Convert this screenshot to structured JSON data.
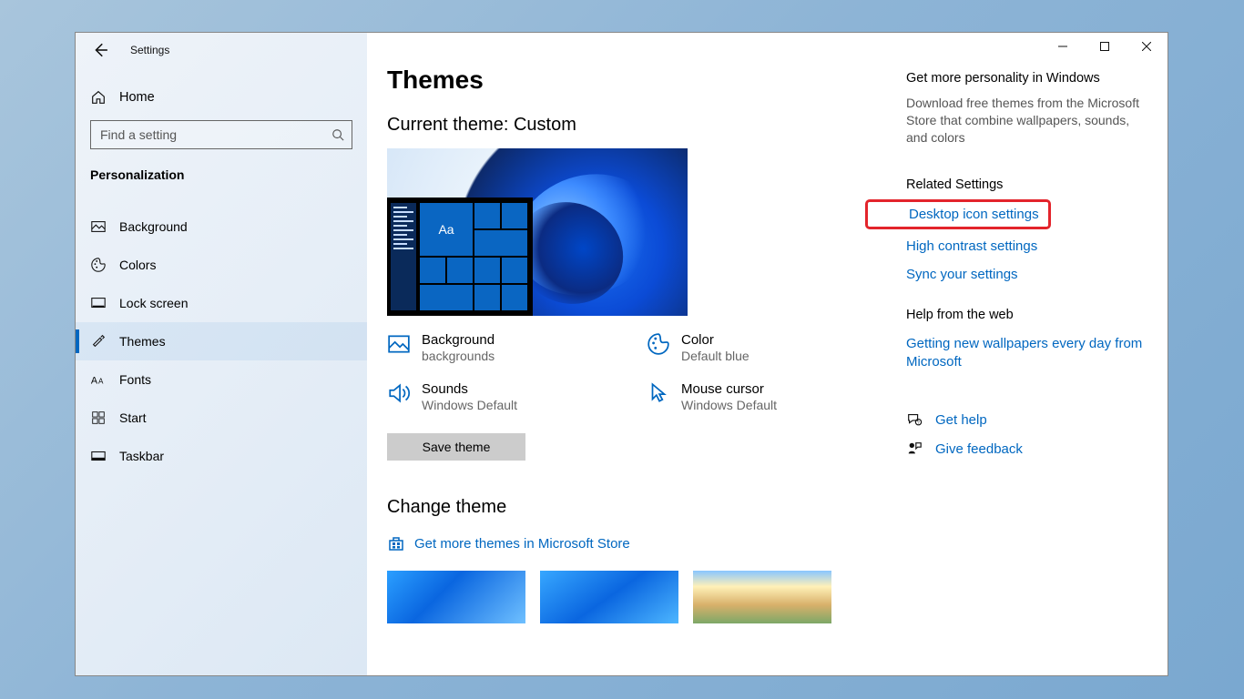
{
  "app_title": "Settings",
  "search_placeholder": "Find a setting",
  "home_label": "Home",
  "category_label": "Personalization",
  "nav": [
    {
      "label": "Background"
    },
    {
      "label": "Colors"
    },
    {
      "label": "Lock screen"
    },
    {
      "label": "Themes"
    },
    {
      "label": "Fonts"
    },
    {
      "label": "Start"
    },
    {
      "label": "Taskbar"
    }
  ],
  "page_heading": "Themes",
  "current_theme_heading": "Current theme: Custom",
  "preview_sample_text": "Aa",
  "props": {
    "background": {
      "label": "Background",
      "value": "backgrounds"
    },
    "color": {
      "label": "Color",
      "value": "Default blue"
    },
    "sounds": {
      "label": "Sounds",
      "value": "Windows Default"
    },
    "cursor": {
      "label": "Mouse cursor",
      "value": "Windows Default"
    }
  },
  "save_button": "Save theme",
  "change_theme_heading": "Change theme",
  "store_link": "Get more themes in Microsoft Store",
  "right": {
    "personality_h": "Get more personality in Windows",
    "personality_p": "Download free themes from the Microsoft Store that combine wallpapers, sounds, and colors",
    "related_h": "Related Settings",
    "links": {
      "desktop_icon": "Desktop icon settings",
      "high_contrast": "High contrast settings",
      "sync": "Sync your settings"
    },
    "help_h": "Help from the web",
    "help_link_wallpapers": "Getting new wallpapers every day from Microsoft",
    "get_help": "Get help",
    "give_feedback": "Give feedback"
  }
}
